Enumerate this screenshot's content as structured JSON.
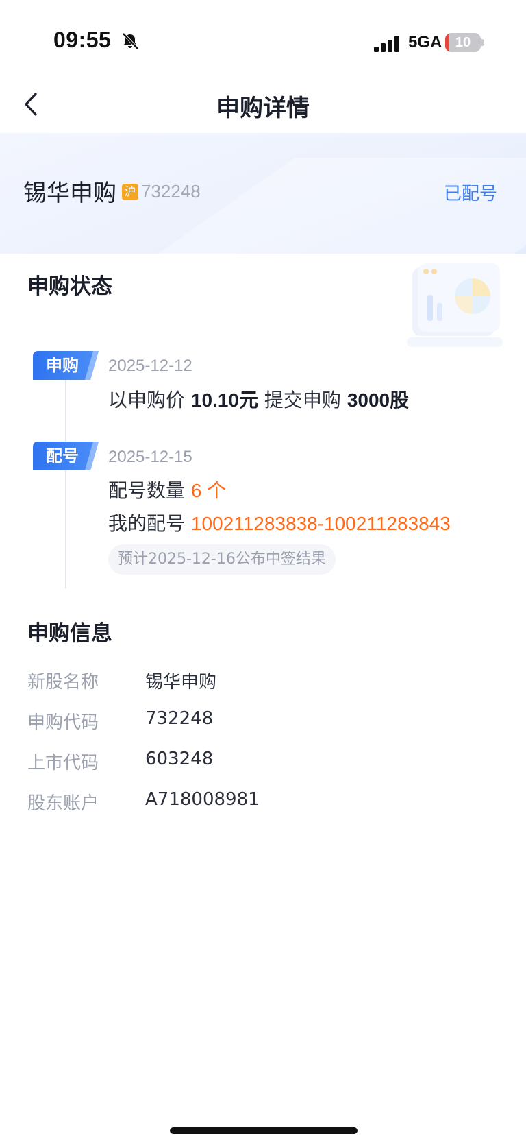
{
  "status_bar": {
    "time": "09:55",
    "network": "5GA",
    "battery_level": "10",
    "battery_fraction": 0.1
  },
  "nav": {
    "title": "申购详情",
    "back_icon": "chevron-left-icon"
  },
  "header": {
    "stock_name": "锡华申购",
    "exchange_badge": "沪",
    "stock_code": "732248",
    "status": "已配号"
  },
  "status_section": {
    "title": "申购状态",
    "steps": [
      {
        "tag": "申购",
        "date": "2025-12-12",
        "line_prefix": "以申购价",
        "price": "10.10元",
        "line_middle": "提交申购",
        "quantity": "3000股"
      },
      {
        "tag": "配号",
        "date": "2025-12-15",
        "count_label": "配号数量",
        "count_value": "6 个",
        "numbers_label": "我的配号",
        "numbers_value": "100211283838-100211283843",
        "hint": "预计2025-12-16公布中签结果"
      }
    ]
  },
  "info_section": {
    "title": "申购信息",
    "rows": [
      {
        "label": "新股名称",
        "value": "锡华申购"
      },
      {
        "label": "申购代码",
        "value": "732248"
      },
      {
        "label": "上市代码",
        "value": "603248"
      },
      {
        "label": "股东账户",
        "value": "A718008981"
      }
    ]
  },
  "colors": {
    "accent_blue": "#3f7ff0",
    "highlight_orange": "#ff6a1a",
    "badge_orange": "#f5a623",
    "battery_red": "#e5473d"
  }
}
